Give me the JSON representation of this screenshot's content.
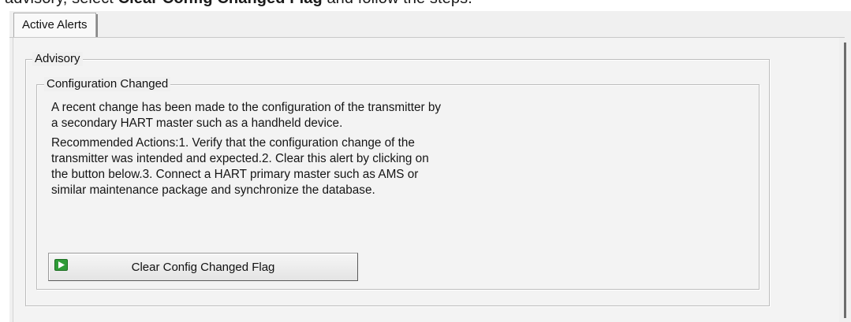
{
  "doc": {
    "prefix": "advisory, select ",
    "bold": "Clear Config Changed Flag",
    "suffix": " and follow the steps."
  },
  "tabs": [
    {
      "label": "Active Alerts",
      "active": true
    }
  ],
  "advisory": {
    "title": "Advisory",
    "group": {
      "title": "Configuration Changed",
      "description": "A recent change has been made to the configuration of the transmitter by a secondary HART master such as a handheld device.",
      "actions": "Recommended Actions:1. Verify that the configuration change of the transmitter was intended and expected.2. Clear this alert by clicking on the button below.3. Connect a HART primary master such as AMS or similar maintenance package and synchronize the database.",
      "button": {
        "label": "Clear Config Changed Flag",
        "icon": "green-play-icon"
      }
    }
  },
  "colors": {
    "panel_bg": "#f0f0f0",
    "icon_green": "#2e9b37"
  }
}
